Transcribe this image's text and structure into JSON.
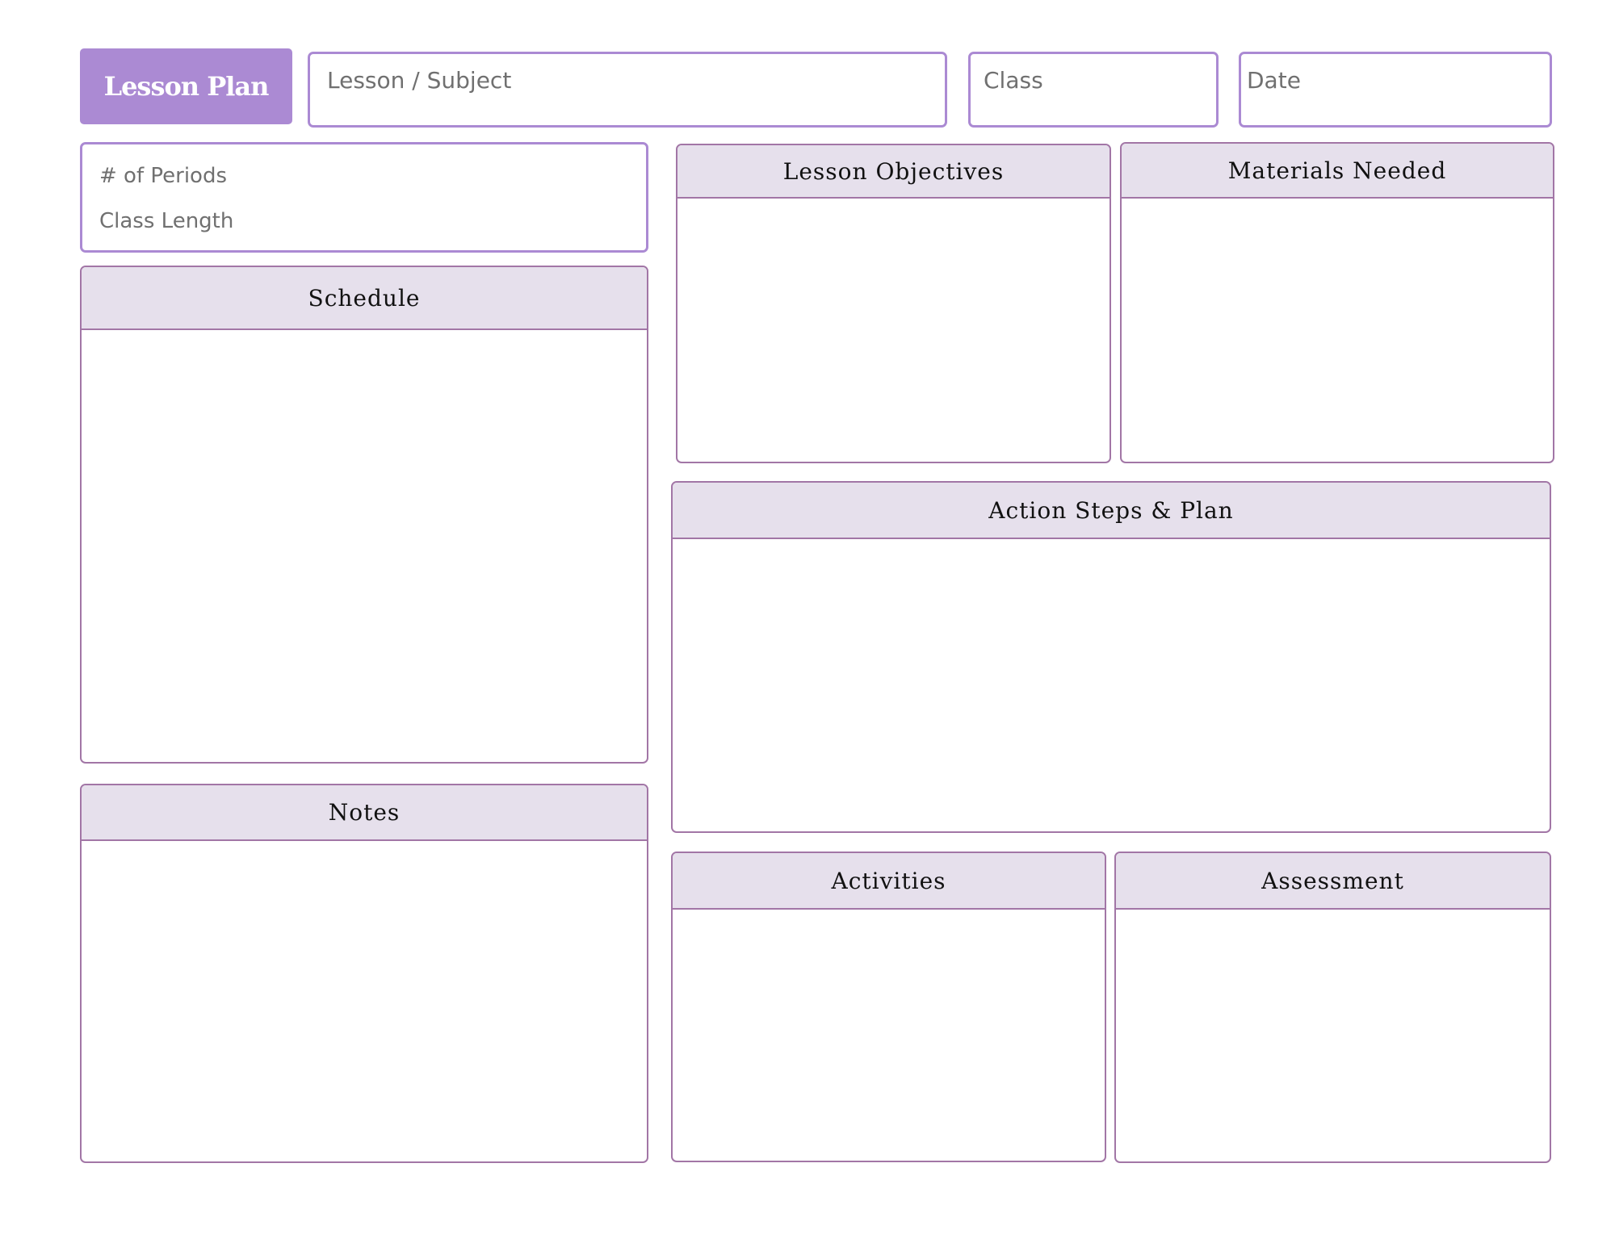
{
  "header": {
    "title": "Lesson Plan",
    "lesson_subject_label": "Lesson / Subject",
    "class_label": "Class",
    "date_label": "Date"
  },
  "meta": {
    "periods_label": "# of Periods",
    "class_length_label": "Class Length"
  },
  "sections": {
    "schedule": "Schedule",
    "notes": "Notes",
    "lesson_objectives": "Lesson Objectives",
    "materials_needed": "Materials Needed",
    "action_steps": "Action Steps & Plan",
    "activities": "Activities",
    "assessment": "Assessment"
  },
  "colors": {
    "accent": "#ab8ad3",
    "panel_border": "#a276a6",
    "panel_header_bg": "#e6e0ec"
  }
}
